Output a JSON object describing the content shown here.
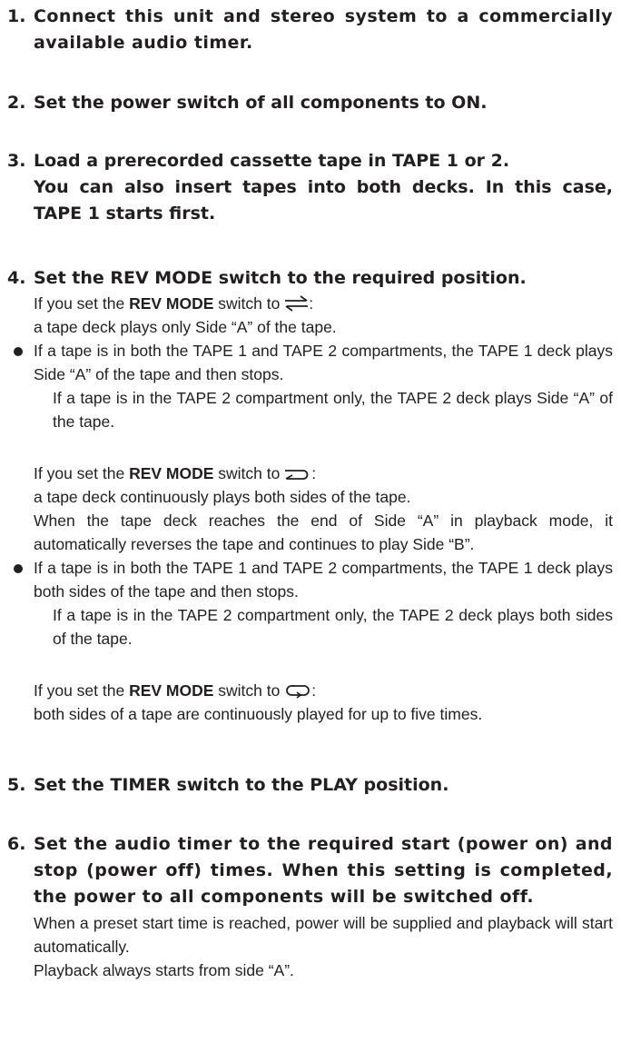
{
  "steps": [
    {
      "num": "1.",
      "head": "Connect this unit and stereo system to a commercially available audio timer."
    },
    {
      "num": "2.",
      "head": "Set the power switch of all components to ON."
    },
    {
      "num": "3.",
      "head_lines": [
        "Load a prerecorded cassette tape in TAPE 1 or 2.",
        "You can also insert tapes into both decks. In this case, TAPE 1 starts first."
      ]
    },
    {
      "num": "4.",
      "head": "Set the REV MODE switch to the required position.",
      "modes": [
        {
          "icon": "one-way-arrows-icon",
          "intro_prefix": "If you set the ",
          "intro_bold": "REV MODE",
          "intro_suffix": " switch to ",
          "intro_end": ":",
          "lines": [
            "a tape deck plays only Side “A” of the tape."
          ],
          "bullet": "If a tape is in both the TAPE 1 and TAPE 2 compartments, the TAPE 1 deck plays Side “A” of the tape and then stops.",
          "sub": "If a tape is in the TAPE 2 compartment only, the TAPE 2 deck plays Side “A” of the tape."
        },
        {
          "icon": "reverse-once-icon",
          "intro_prefix": "If you set the ",
          "intro_bold": "REV MODE",
          "intro_suffix": " switch to ",
          "intro_end": ":",
          "lines": [
            "a tape deck continuously plays both sides of the tape.",
            "When the tape deck reaches the end of Side “A” in playback mode, it automatically reverses the tape and continues to play Side “B”."
          ],
          "bullet": "If a tape is in both the TAPE 1 and TAPE 2 compartments, the TAPE 1 deck plays both sides of the tape and then stops.",
          "sub": "If a tape is in the TAPE 2 compartment only, the TAPE 2 deck plays both sides of the tape."
        },
        {
          "icon": "continuous-loop-icon",
          "intro_prefix": "If you set the ",
          "intro_bold": "REV MODE",
          "intro_suffix": " switch to ",
          "intro_end": ":",
          "lines": [
            "both sides of a tape are continuously played for up to five times."
          ]
        }
      ]
    },
    {
      "num": "5.",
      "head": "Set the TIMER switch to the PLAY position."
    },
    {
      "num": "6.",
      "head": "Set the audio timer to the required start (power on) and stop (power off) times. When this setting is completed, the power to all components will be switched off.",
      "lines": [
        "When a preset start time is reached, power will be supplied and playback will start automatically.",
        "Playback always starts from side “A”."
      ]
    }
  ]
}
